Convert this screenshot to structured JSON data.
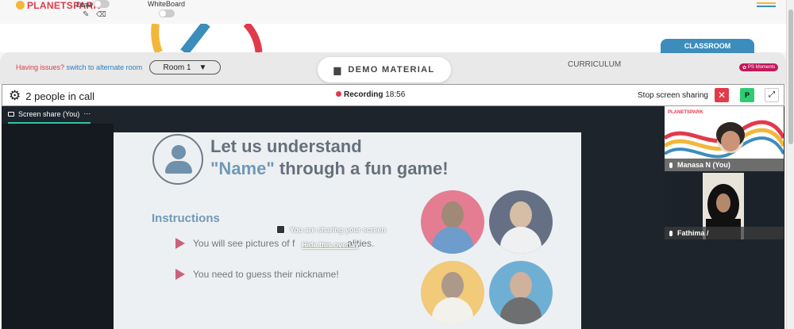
{
  "app": {
    "logo": "PLANETSPARK",
    "brand_colors": {
      "red": "#e23a4b",
      "blue": "#3c8dbc",
      "green": "#2ecc71"
    }
  },
  "toolbar": {
    "draw_label": "Draw",
    "whiteboard_label": "WhiteBoard"
  },
  "header": {
    "issues_text": "Having issues?",
    "switch_link": "switch to alternate room",
    "room_select": "Room 1",
    "demo_material": "DEMO MATERIAL",
    "curriculum": "CURRICULUM",
    "classroom": "CLASSROOM",
    "ps_moments": "PS Moments"
  },
  "call": {
    "people": "2 people in call",
    "recording_label": "Recording",
    "recording_time": "18:56",
    "stop_share": "Stop screen sharing",
    "p_button": "P"
  },
  "share": {
    "tab_label": "Screen share (You)",
    "sharing_notice": "You are sharing your screen",
    "hide_overlay": "Hide this overlay"
  },
  "slide": {
    "title_line1": "Let us understand",
    "title_highlight": "\"Name\"",
    "title_line2_rest": " through a fun game!",
    "instructions": "Instructions",
    "bullet1_a": "You will see pictures of f",
    "bullet1_b": "alities.",
    "bullet2": "You need to guess their nickname!"
  },
  "participants": [
    {
      "name": "Manasa N (You)"
    },
    {
      "name": "Fathima /"
    }
  ]
}
